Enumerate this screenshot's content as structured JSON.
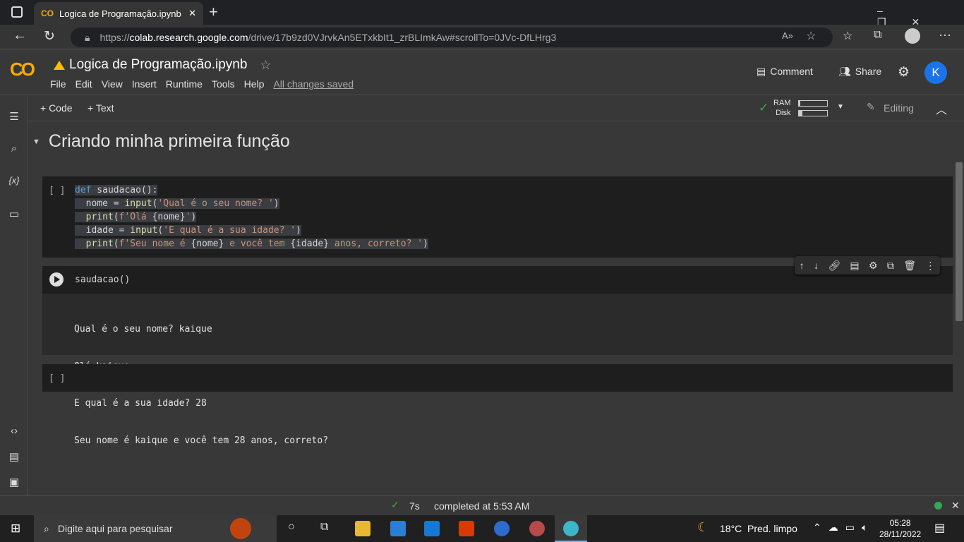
{
  "browser": {
    "tab_title": "Logica de Programação.ipynb - C",
    "url_prefix": "https://",
    "url_host": "colab.research.google.com",
    "url_path": "/drive/17b9zd0VJrvkAn5ETxkbIt1_zrBLImkAw#scrollTo=0JVc-DfLHrg3"
  },
  "colab": {
    "logo": "CO",
    "title": "Logica de Programação.ipynb",
    "menu": [
      "File",
      "Edit",
      "View",
      "Insert",
      "Runtime",
      "Tools",
      "Help"
    ],
    "saved": "All changes saved",
    "comment": "Comment",
    "share": "Share",
    "avatar": "K"
  },
  "toolbar": {
    "add_code": "+ Code",
    "add_text": "+ Text",
    "ram": "RAM",
    "disk": "Disk",
    "ram_usage": 0.05,
    "disk_usage": 0.12,
    "mode": "Editing"
  },
  "section": {
    "title": "Criando minha primeira função"
  },
  "cells": [
    {
      "prompt": "[ ]",
      "code": [
        [
          [
            "def",
            "kw"
          ],
          [
            " saudacao():",
            "tx"
          ]
        ],
        [
          [
            "  nome = ",
            "tx"
          ],
          [
            "input",
            "fn"
          ],
          [
            "(",
            "tx"
          ],
          [
            "'Qual é o seu nome? '",
            "st"
          ],
          [
            ")",
            "tx"
          ]
        ],
        [
          [
            "  ",
            "tx"
          ],
          [
            "print",
            "fn"
          ],
          [
            "(",
            "tx"
          ],
          [
            "f'Olá ",
            "st"
          ],
          [
            "{nome}",
            "tx"
          ],
          [
            "'",
            "st"
          ],
          [
            ")",
            "tx"
          ]
        ],
        [
          [
            "  idade = ",
            "tx"
          ],
          [
            "input",
            "fn"
          ],
          [
            "(",
            "tx"
          ],
          [
            "'E qual é a sua idade? '",
            "st"
          ],
          [
            ")",
            "tx"
          ]
        ],
        [
          [
            "  ",
            "tx"
          ],
          [
            "print",
            "fn"
          ],
          [
            "(",
            "tx"
          ],
          [
            "f'Seu nome é ",
            "st"
          ],
          [
            "{nome}",
            "tx"
          ],
          [
            " e você tem ",
            "st"
          ],
          [
            "{idade}",
            "tx"
          ],
          [
            " anos, correto? '",
            "st"
          ],
          [
            ")",
            "tx"
          ]
        ]
      ]
    },
    {
      "code_text": "saudacao()",
      "output": [
        "Qual é o seu nome? kaique",
        "Olá kaique",
        "E qual é a sua idade? 28",
        "Seu nome é kaique e você tem 28 anos, correto?"
      ]
    },
    {
      "prompt": "[ ]"
    }
  ],
  "status": {
    "time": "7s",
    "text": "completed at 5:53 AM"
  },
  "taskbar": {
    "search": "Digite aqui para pesquisar",
    "weather": "18°C  Pred. limpo",
    "clock": "05:28",
    "date": "28/11/2022"
  },
  "colors": {
    "accent": "#f9ab00",
    "avatar": "#1a73e8",
    "ok": "#34a853"
  }
}
